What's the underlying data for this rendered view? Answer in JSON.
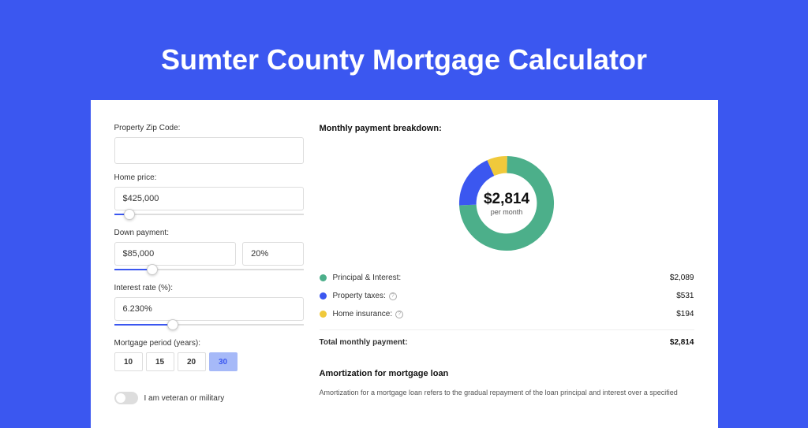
{
  "title": "Sumter County Mortgage Calculator",
  "left": {
    "zip_label": "Property Zip Code:",
    "zip_value": "",
    "home_price_label": "Home price:",
    "home_price_value": "$425,000",
    "home_price_slider_pct": 8,
    "down_payment_label": "Down payment:",
    "down_payment_value": "$85,000",
    "down_payment_pct": "20%",
    "down_payment_slider_pct": 20,
    "interest_label": "Interest rate (%):",
    "interest_value": "6.230%",
    "interest_slider_pct": 31,
    "period_label": "Mortgage period (years):",
    "periods": [
      "10",
      "15",
      "20",
      "30"
    ],
    "period_active": 3,
    "veteran_label": "I am veteran or military"
  },
  "right": {
    "breakdown_title": "Monthly payment breakdown:",
    "donut_amount": "$2,814",
    "donut_sub": "per month",
    "legend": [
      {
        "label": "Principal & Interest:",
        "value": "$2,089",
        "color": "#4caf8a",
        "info": false
      },
      {
        "label": "Property taxes:",
        "value": "$531",
        "color": "#3b57f0",
        "info": true
      },
      {
        "label": "Home insurance:",
        "value": "$194",
        "color": "#f0c93b",
        "info": true
      }
    ],
    "total_label": "Total monthly payment:",
    "total_value": "$2,814",
    "amort_title": "Amortization for mortgage loan",
    "amort_text": "Amortization for a mortgage loan refers to the gradual repayment of the loan principal and interest over a specified",
    "chart_data": {
      "type": "pie",
      "title": "Monthly payment breakdown",
      "series": [
        {
          "name": "Principal & Interest",
          "value": 2089,
          "color": "#4caf8a"
        },
        {
          "name": "Property taxes",
          "value": 531,
          "color": "#3b57f0"
        },
        {
          "name": "Home insurance",
          "value": 194,
          "color": "#f0c93b"
        }
      ],
      "total": 2814
    }
  }
}
